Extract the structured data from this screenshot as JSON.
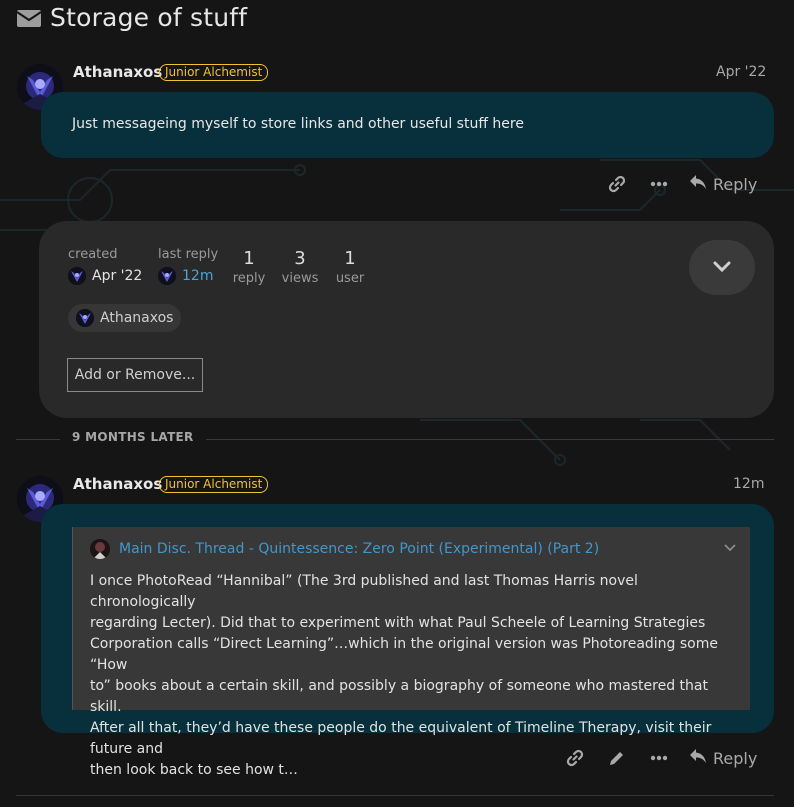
{
  "topic": {
    "title": "Storage of stuff",
    "title_icon": "envelope-icon"
  },
  "posts": [
    {
      "username": "Athanaxos",
      "badge": "Junior Alchemist",
      "date": "Apr '22",
      "content": "Just messageing myself to store links and other useful stuff here",
      "actions": {
        "reply_label": "Reply"
      }
    },
    {
      "username": "Athanaxos",
      "badge": "Junior Alchemist",
      "date": "12m",
      "quote": {
        "title": "Main Disc. Thread - Quintessence: Zero Point (Experimental) (Part 2)",
        "lines": [
          "I once PhotoRead “Hannibal” (The 3rd published and last Thomas Harris novel chronologically",
          "regarding Lecter). Did that to experiment with what Paul Scheele of Learning Strategies",
          "Corporation calls “Direct Learning”…which in the original version was Photoreading some “How",
          "to” books about a certain skill, and possibly a biography of someone who mastered that skill.",
          "After all that, they’d have these people do the equivalent of Timeline Therapy, visit their future and",
          "then look back to see how t…"
        ]
      },
      "actions": {
        "reply_label": "Reply"
      }
    }
  ],
  "topic_map": {
    "created_label": "created",
    "created_value": "Apr '22",
    "last_reply_label": "last reply",
    "last_reply_value": "12m",
    "stats": [
      {
        "number": "1",
        "label": "reply"
      },
      {
        "number": "3",
        "label": "views"
      },
      {
        "number": "1",
        "label": "user"
      }
    ],
    "participant": "Athanaxos",
    "add_remove_label": "Add or Remove..."
  },
  "time_gap": "9 MONTHS LATER",
  "colors": {
    "background": "#151515",
    "post_bubble": "#08303c",
    "badge": "#f2c230",
    "link": "#3f97cf"
  }
}
